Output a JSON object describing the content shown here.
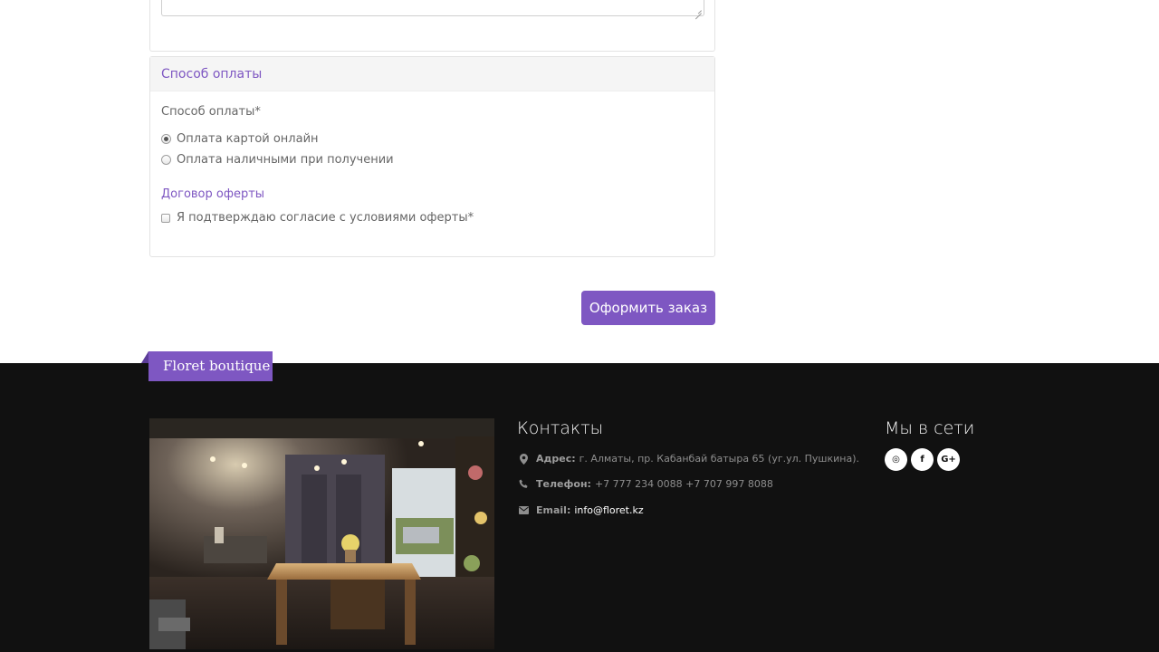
{
  "payment": {
    "heading": "Способ оплаты",
    "field_label": "Способ оплаты*",
    "options": [
      {
        "label": "Оплата картой онлайн",
        "checked": true
      },
      {
        "label": "Оплата наличными при получении",
        "checked": false
      }
    ],
    "offer_link": "Договор оферты",
    "consent_label": "Я подтверждаю согласие с условиями оферты*"
  },
  "submit_label": "Оформить заказ",
  "footer": {
    "brand": "Floret boutique",
    "contacts_title": "Контакты",
    "address_label": "Адрес:",
    "address_value": "г. Алматы, пр. Кабанбай батыра 65 (уг.ул. Пушкина).",
    "phone_label": "Телефон:",
    "phone_value": "+7 777 234 0088 +7 707 997 8088",
    "email_label": "Email:",
    "email_value": "info@floret.kz",
    "social_title": "Мы в сети",
    "social": [
      {
        "icon": "instagram-icon",
        "glyph": "◎"
      },
      {
        "icon": "facebook-icon",
        "glyph": "f"
      },
      {
        "icon": "google-plus-icon",
        "glyph": "G+"
      }
    ]
  },
  "colors": {
    "accent": "#7e57c2",
    "footer_bg": "#111111"
  }
}
